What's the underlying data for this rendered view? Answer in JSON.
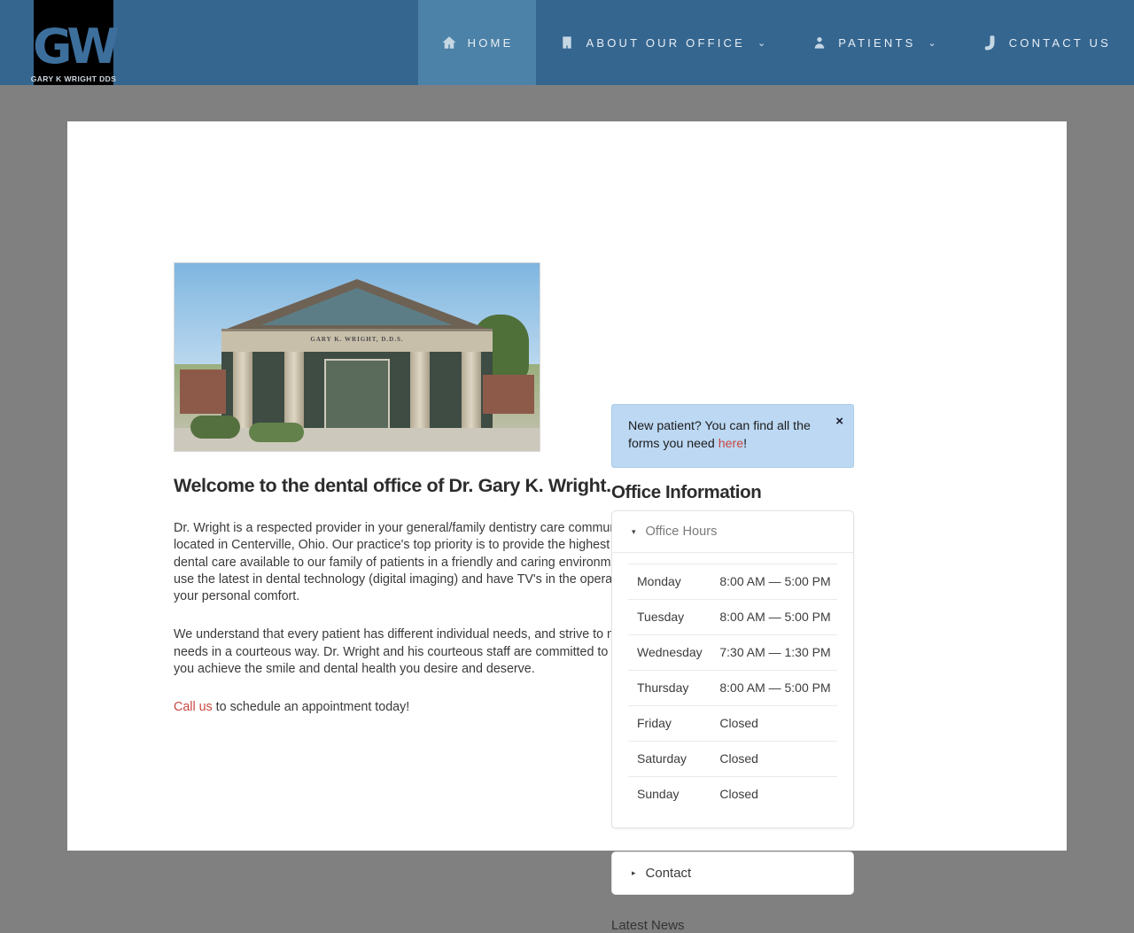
{
  "header": {
    "logo": {
      "mark": "GW",
      "subtitle": "GARY K WRIGHT DDS"
    },
    "nav": [
      {
        "label": "HOME",
        "icon": "home-icon",
        "active": true,
        "caret": ""
      },
      {
        "label": "ABOUT OUR OFFICE",
        "icon": "building-icon",
        "active": false,
        "caret": "⌄"
      },
      {
        "label": "PATIENTS",
        "icon": "person-icon",
        "active": false,
        "caret": "⌄"
      },
      {
        "label": "CONTACT US",
        "icon": "phone-icon",
        "active": false,
        "caret": ""
      }
    ],
    "colors": {
      "bar": "#356690",
      "active_tab": "#4d82a8",
      "nav_text": "#e8eef4"
    }
  },
  "main": {
    "photo_alt": "GARY K. WRIGHT, D.D.S.",
    "photo_sign": "GARY K. WRIGHT, D.D.S.",
    "title": "Welcome to the dental office of Dr. Gary K. Wright.",
    "paragraph1": "Dr. Wright is a respected provider in your general/family dentistry care community, located in Centerville, Ohio. Our practice's top priority is to provide the highest quality dental care available to our family of patients in a friendly and caring environment. We use the latest in dental technology (digital imaging) and have TV's in the operatories for your personal comfort.",
    "paragraph2": "We understand that every patient has different individual needs, and strive to meet those needs in a courteous way. Dr. Wright and his courteous staff are committed to helping you achieve the smile and dental health you desire and deserve.",
    "cta_link": "Call us",
    "cta_rest": " to schedule an appointment today!"
  },
  "sidebar": {
    "alert": {
      "text_before": "New patient? You can find all the forms you need ",
      "link": "here",
      "text_after": "!",
      "close_label": "×",
      "bg": "#bcd8f3",
      "link_color": "#c9473f"
    },
    "heading": "Office Information",
    "office_hours": {
      "title": "Office Hours",
      "expanded": true,
      "marker": "▾",
      "rows": [
        {
          "day": "Monday",
          "time": "8:00 AM — 5:00 PM"
        },
        {
          "day": "Tuesday",
          "time": "8:00 AM — 5:00 PM"
        },
        {
          "day": "Wednesday",
          "time": "7:30 AM — 1:30 PM"
        },
        {
          "day": "Thursday",
          "time": "8:00 AM — 5:00 PM"
        },
        {
          "day": "Friday",
          "time": "Closed"
        },
        {
          "day": "Saturday",
          "time": "Closed"
        },
        {
          "day": "Sunday",
          "time": "Closed"
        }
      ]
    },
    "contact": {
      "title": "Contact",
      "expanded": false,
      "marker": "▸"
    },
    "latest_news": "Latest News"
  }
}
